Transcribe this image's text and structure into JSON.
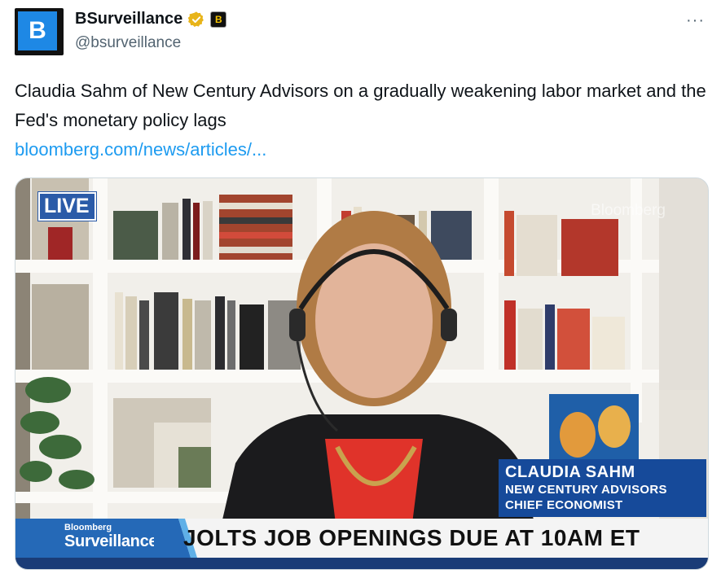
{
  "account": {
    "display_name": "BSurveillance",
    "handle": "@bsurveillance",
    "avatar_letter": "B",
    "affiliate_letter": "B",
    "verified_color": "#e8b419"
  },
  "more_label": "···",
  "tweet": {
    "text": "Claudia Sahm of New Century Advisors on a gradually weakening labor market and the Fed's monetary policy lags",
    "link": "bloomberg.com/news/articles/..."
  },
  "video": {
    "live_badge": "LIVE",
    "watermark": "Bloomberg",
    "guest_name": "CLAUDIA SAHM",
    "guest_org": "NEW CENTURY ADVISORS",
    "guest_title": "CHIEF ECONOMIST",
    "show_brand_small": "Bloomberg",
    "show_brand": "Surveillance",
    "headline": "JOLTS JOB OPENINGS DUE AT 10AM ET",
    "colors": {
      "brand_blue": "#2569b7",
      "lower_third_blue": "#164a9a"
    }
  }
}
